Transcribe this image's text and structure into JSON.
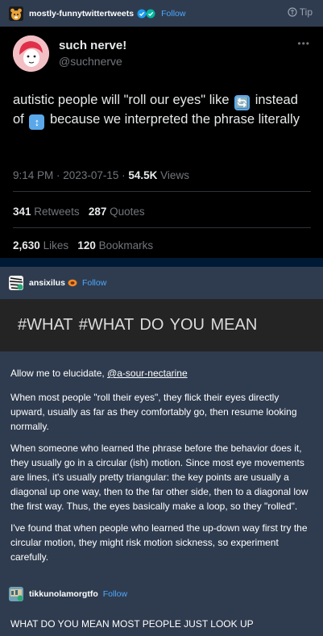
{
  "post1": {
    "blog_name": "mostly-funnytwittertweets",
    "follow": "Follow",
    "tip": "Tip",
    "tweet": {
      "display_name": "such nerve!",
      "handle": "@suchnerve",
      "text_part1": "autistic people will \"roll our eyes\" like",
      "emoji1": "🔄",
      "text_part2": "instead of",
      "emoji2": "↕",
      "text_part3": "because we interpreted the phrase literally",
      "time": "9:14 PM",
      "date": "2023-07-15",
      "views_count": "54.5K",
      "views_label": "Views",
      "retweets_count": "341",
      "retweets_label": "Retweets",
      "quotes_count": "287",
      "quotes_label": "Quotes",
      "likes_count": "2,630",
      "likes_label": "Likes",
      "bookmarks_count": "120",
      "bookmarks_label": "Bookmarks"
    }
  },
  "post2": {
    "blog_name": "ansixilus",
    "follow": "Follow",
    "header_image_text": "#WHAT   #WHAT DO YOU MEAN",
    "intro": "Allow me to elucidate,",
    "mention": "@a-sour-nectarine",
    "paragraph1": "When most people \"roll their eyes\", they flick their eyes directly upward, usually as far as they comfortably go, then resume looking normally.",
    "paragraph2": "When someone who learned the phrase before the behavior does it, they usually go in a circular (ish) motion.  Since most eye movements are lines, it's usually pretty triangular: the key points are usually a diagonal up one way, then to the far other side, then to a diagonal low the first way. Thus, the eyes basically make a loop, so they \"rolled\".",
    "paragraph3": "I've found that when people who learned the up-down way first try the circular motion, they might risk motion sickness, so experiment carefully."
  },
  "post3": {
    "blog_name": "tikkunolamorgtfo",
    "follow": "Follow",
    "text": "WHAT DO YOU MEAN MOST PEOPLE JUST LOOK UP"
  },
  "colors": {
    "dashboard_bg": "#001935",
    "post_bg": "#2f3c4f",
    "link_blue": "#4ea9ff",
    "tweet_bg": "#000000",
    "twitter_gray": "#71767b",
    "verified_blue": "#1d9bf0",
    "verified_green": "#00b8a0"
  }
}
